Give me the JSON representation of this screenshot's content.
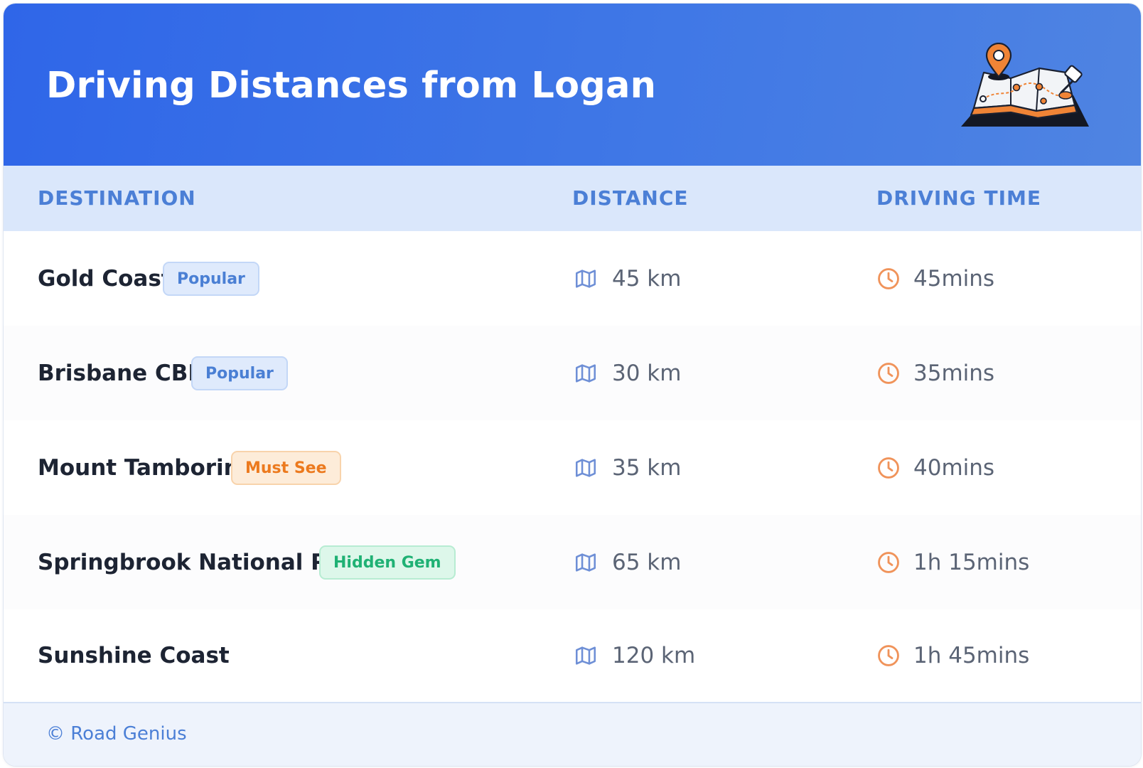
{
  "header": {
    "title": "Driving Distances from Logan",
    "illustration": "map-with-pins-icon"
  },
  "table": {
    "columns": [
      "DESTINATION",
      "DISTANCE",
      "DRIVING TIME"
    ],
    "rows": [
      {
        "destination": "Gold Coast",
        "badge": "Popular",
        "distance": "45 km",
        "time": "45mins"
      },
      {
        "destination": "Brisbane CBD",
        "badge": "Popular",
        "distance": "30 km",
        "time": "35mins"
      },
      {
        "destination": "Mount Tamborine",
        "badge": "Must See",
        "distance": "35 km",
        "time": "40mins"
      },
      {
        "destination": "Springbrook National Park",
        "badge": "Hidden Gem",
        "distance": "65 km",
        "time": "1h 15mins"
      },
      {
        "destination": "Sunshine Coast",
        "badge": "",
        "distance": "120 km",
        "time": "1h 45mins"
      }
    ],
    "icons": {
      "distance": "map-icon",
      "time": "clock-icon"
    }
  },
  "colors": {
    "header_gradient_start": "#2f66e8",
    "header_gradient_end": "#4f84e2",
    "header_text": "#ffffff",
    "column_header_bg": "#dae7fb",
    "column_header_text": "#4b7fd6",
    "map_icon": "#6e8fd6",
    "clock_icon": "#f0935a",
    "badge_popular": "#4a7fd4",
    "badge_must_see": "#ec7a1e",
    "badge_hidden_gem": "#1fb174"
  },
  "footer": {
    "copyright": "© Road Genius"
  }
}
